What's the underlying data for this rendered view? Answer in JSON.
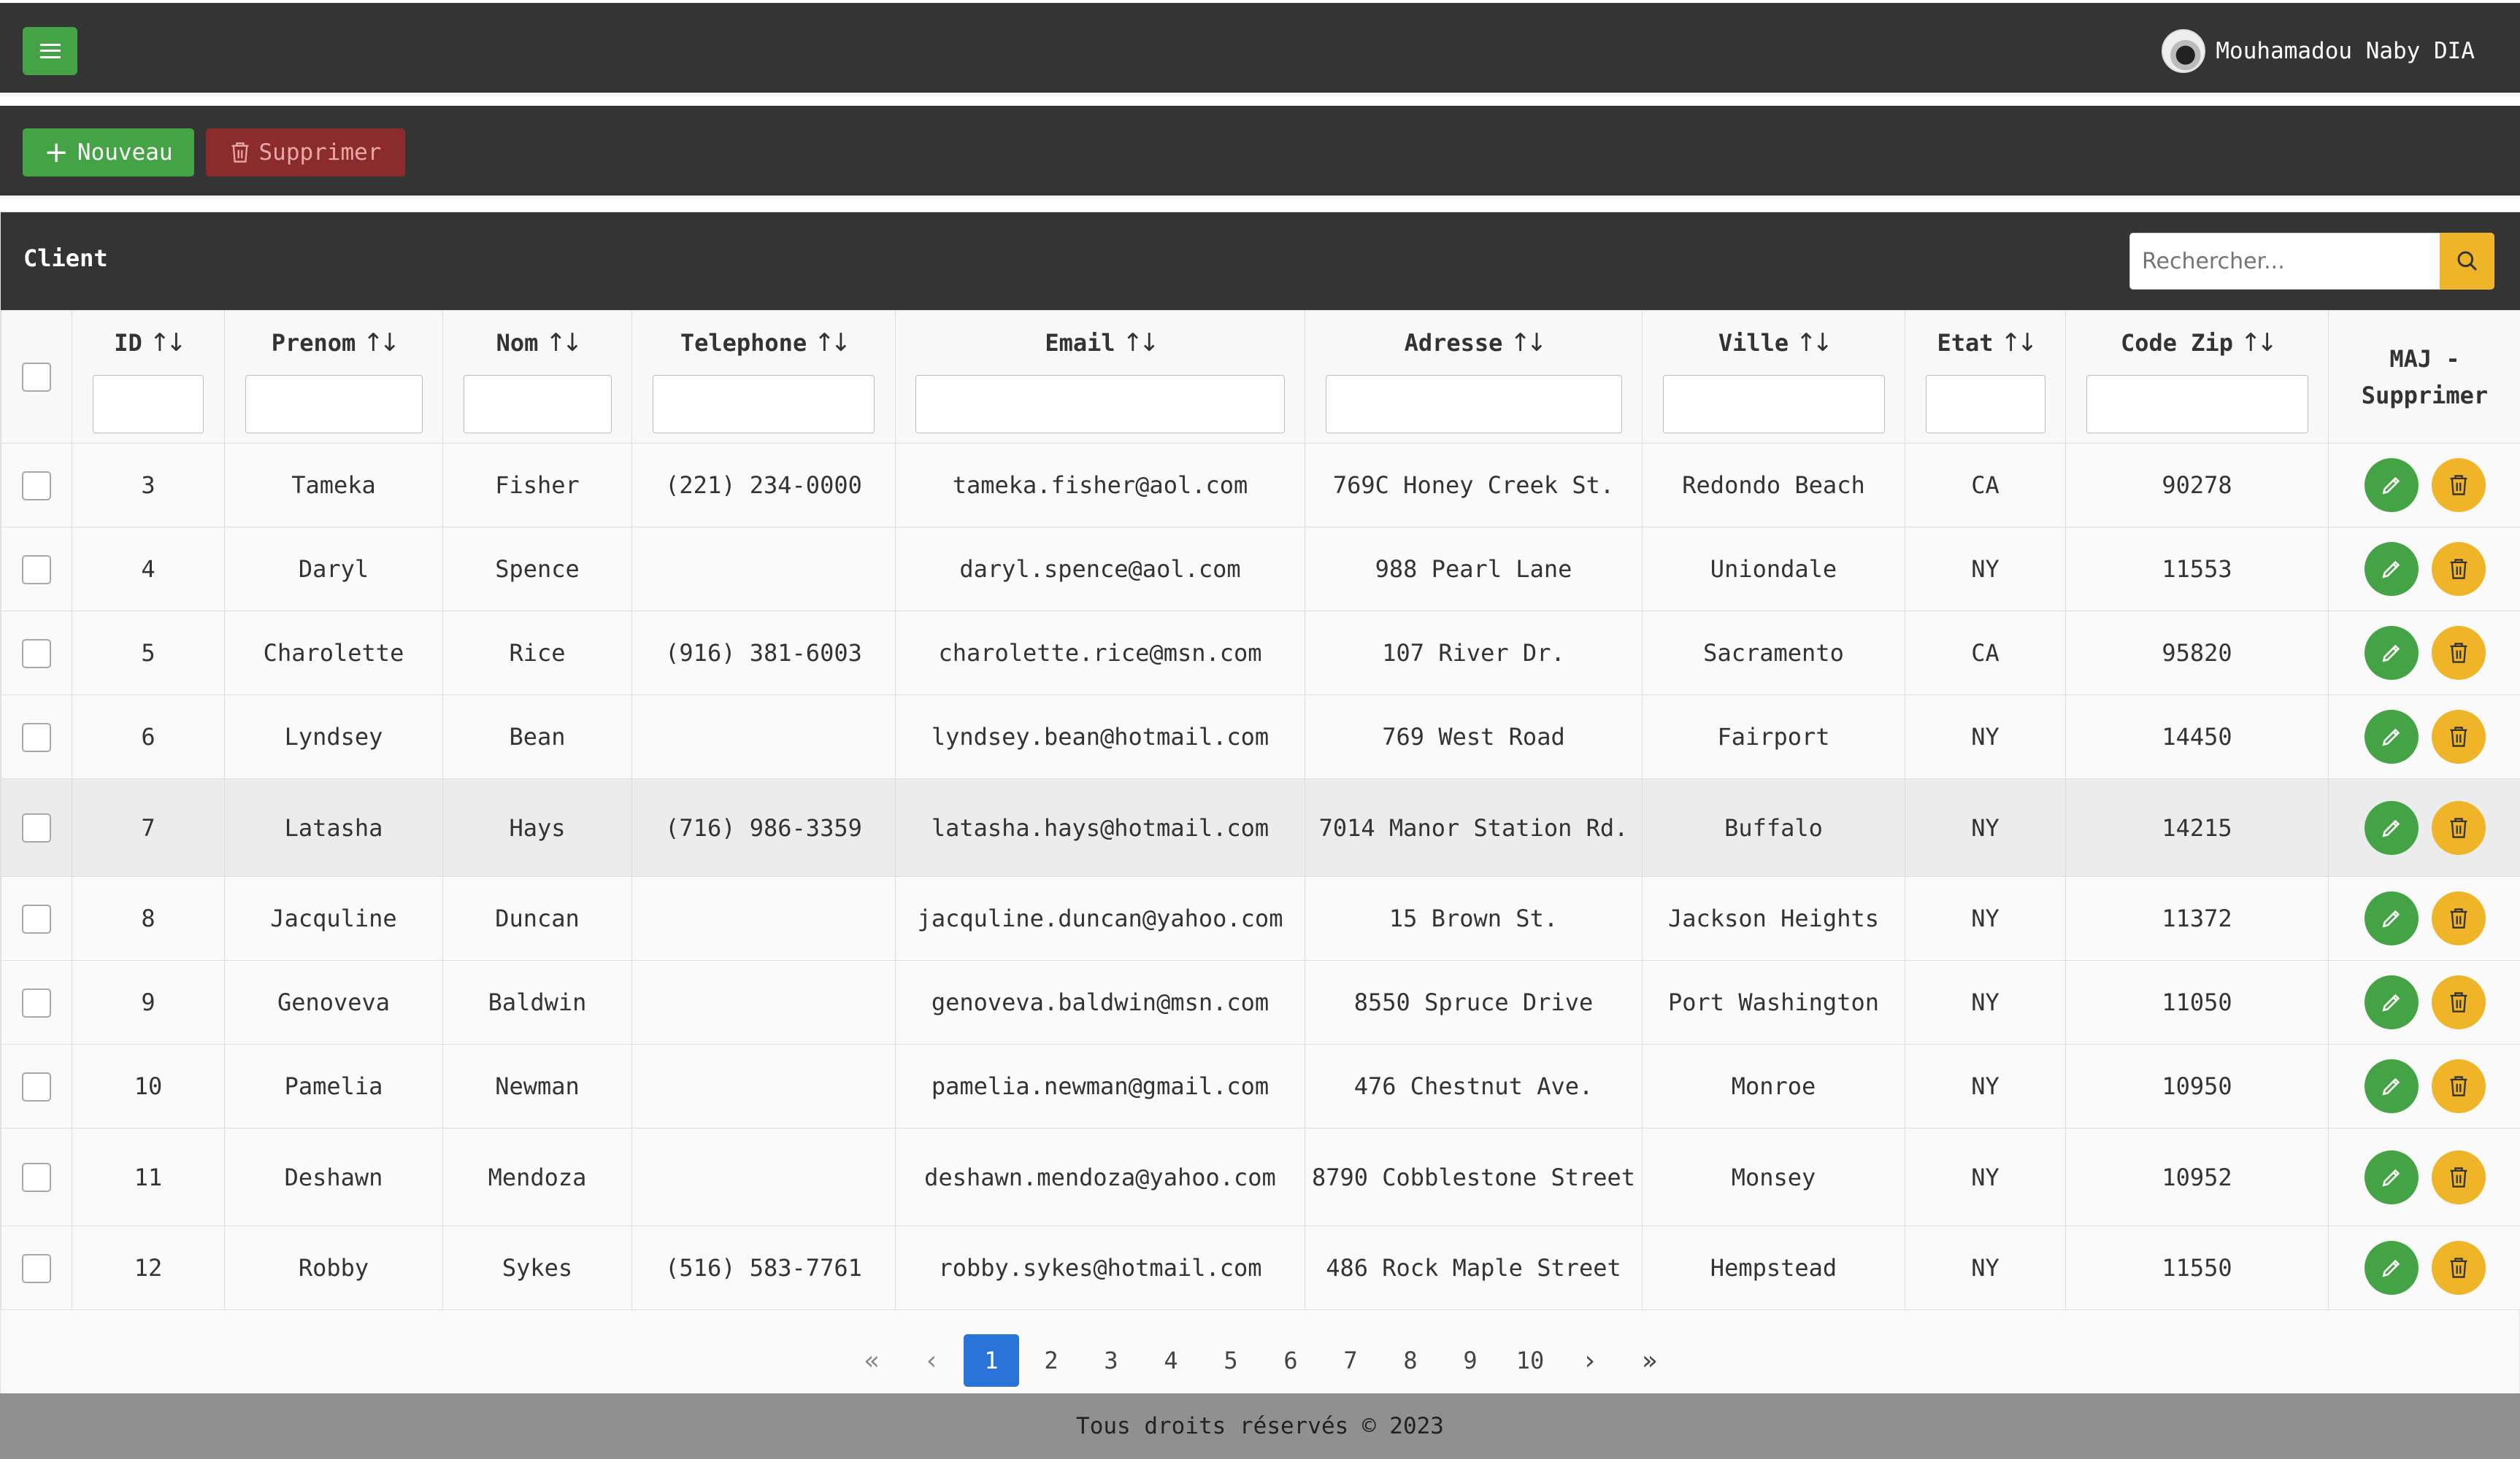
{
  "header": {
    "user_name": "Mouhamadou Naby DIA"
  },
  "toolbar": {
    "new_label": "Nouveau",
    "delete_label": "Supprimer"
  },
  "panel": {
    "title": "Client",
    "search_placeholder": "Rechercher..."
  },
  "columns": {
    "id": "ID",
    "prenom": "Prenom",
    "nom": "Nom",
    "telephone": "Telephone",
    "email": "Email",
    "adresse": "Adresse",
    "ville": "Ville",
    "etat": "Etat",
    "zip": "Code Zip",
    "actions": "MAJ - Supprimer"
  },
  "rows": [
    {
      "id": "3",
      "prenom": "Tameka",
      "nom": "Fisher",
      "telephone": "(221) 234-0000",
      "email": "tameka.fisher@aol.com",
      "adresse": "769C Honey Creek St.",
      "ville": "Redondo Beach",
      "etat": "CA",
      "zip": "90278"
    },
    {
      "id": "4",
      "prenom": "Daryl",
      "nom": "Spence",
      "telephone": "",
      "email": "daryl.spence@aol.com",
      "adresse": "988 Pearl Lane",
      "ville": "Uniondale",
      "etat": "NY",
      "zip": "11553"
    },
    {
      "id": "5",
      "prenom": "Charolette",
      "nom": "Rice",
      "telephone": "(916) 381-6003",
      "email": "charolette.rice@msn.com",
      "adresse": "107 River Dr.",
      "ville": "Sacramento",
      "etat": "CA",
      "zip": "95820"
    },
    {
      "id": "6",
      "prenom": "Lyndsey",
      "nom": "Bean",
      "telephone": "",
      "email": "lyndsey.bean@hotmail.com",
      "adresse": "769 West Road",
      "ville": "Fairport",
      "etat": "NY",
      "zip": "14450"
    },
    {
      "id": "7",
      "prenom": "Latasha",
      "nom": "Hays",
      "telephone": "(716) 986-3359",
      "email": "latasha.hays@hotmail.com",
      "adresse": "7014 Manor Station Rd.",
      "ville": "Buffalo",
      "etat": "NY",
      "zip": "14215"
    },
    {
      "id": "8",
      "prenom": "Jacquline",
      "nom": "Duncan",
      "telephone": "",
      "email": "jacquline.duncan@yahoo.com",
      "adresse": "15 Brown St.",
      "ville": "Jackson Heights",
      "etat": "NY",
      "zip": "11372"
    },
    {
      "id": "9",
      "prenom": "Genoveva",
      "nom": "Baldwin",
      "telephone": "",
      "email": "genoveva.baldwin@msn.com",
      "adresse": "8550 Spruce Drive",
      "ville": "Port Washington",
      "etat": "NY",
      "zip": "11050"
    },
    {
      "id": "10",
      "prenom": "Pamelia",
      "nom": "Newman",
      "telephone": "",
      "email": "pamelia.newman@gmail.com",
      "adresse": "476 Chestnut Ave.",
      "ville": "Monroe",
      "etat": "NY",
      "zip": "10950"
    },
    {
      "id": "11",
      "prenom": "Deshawn",
      "nom": "Mendoza",
      "telephone": "",
      "email": "deshawn.mendoza@yahoo.com",
      "adresse": "8790 Cobblestone Street",
      "ville": "Monsey",
      "etat": "NY",
      "zip": "10952"
    },
    {
      "id": "12",
      "prenom": "Robby",
      "nom": "Sykes",
      "telephone": "(516) 583-7761",
      "email": "robby.sykes@hotmail.com",
      "adresse": "486 Rock Maple Street",
      "ville": "Hempstead",
      "etat": "NY",
      "zip": "11550"
    }
  ],
  "pagination": {
    "pages": [
      "1",
      "2",
      "3",
      "4",
      "5",
      "6",
      "7",
      "8",
      "9",
      "10"
    ],
    "current": "1"
  },
  "footer": {
    "text": "Tous droits réservés © 2023"
  },
  "colors": {
    "green": "#44a344",
    "red": "#8c2b2b",
    "yellow": "#f0b429",
    "dark": "#343434",
    "active_page": "#2a73d8"
  }
}
